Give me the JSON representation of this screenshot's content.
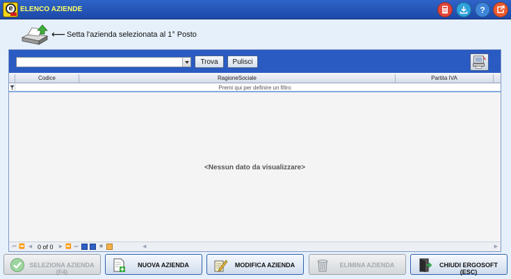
{
  "window": {
    "title": "ELENCO AZIENDE"
  },
  "titlebar_icons": [
    {
      "name": "calculator-icon",
      "color": "#e0453a"
    },
    {
      "name": "download-icon",
      "color": "#2fa2dc"
    },
    {
      "name": "help-icon",
      "color": "#3f86da"
    },
    {
      "name": "exit-icon",
      "color": "#ec5a2e"
    }
  ],
  "hint": {
    "arrow": "⟵",
    "text": "Setta l'azienda selezionata al 1° Posto"
  },
  "search": {
    "value": "",
    "trova_label": "Trova",
    "pulisci_label": "Pulisci"
  },
  "grid": {
    "columns": [
      "Codice",
      "RagioneSociale",
      "Partita IVA"
    ],
    "filter_prompt": "Premi qui per definire un filtro",
    "empty_message": "<Nessun dato da visualizzare>"
  },
  "navigator": {
    "record_count": "0 of 0"
  },
  "buttons": {
    "seleziona": "SELEZIONA AZIENDA (F4)",
    "nuova": "NUOVA AZIENDA",
    "modifica": "MODIFICA AZIENDA",
    "elimina": "ELIMINA AZIENDA",
    "chiudi": "CHIUDI ERGOSOFT (ESC)"
  }
}
